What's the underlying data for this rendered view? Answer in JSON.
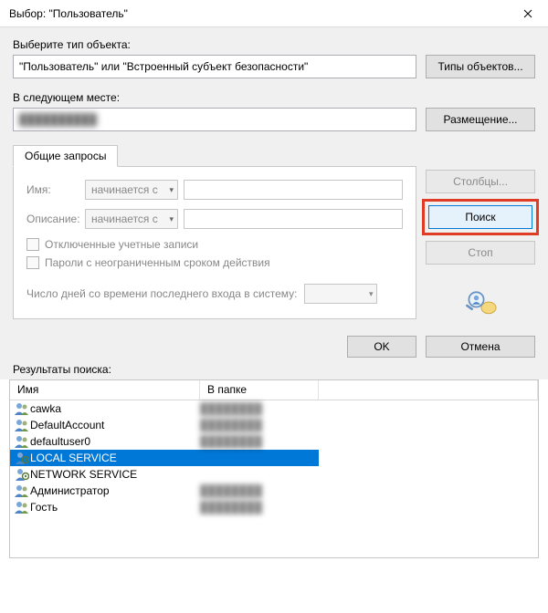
{
  "titlebar": {
    "title": "Выбор: \"Пользователь\""
  },
  "section": {
    "object_type_label": "Выберите тип объекта:",
    "object_type_value": "\"Пользователь\" или \"Встроенный субъект безопасности\"",
    "object_types_button": "Типы объектов...",
    "location_label": "В следующем месте:",
    "location_value": "██████████",
    "locations_button": "Размещение..."
  },
  "tabs": {
    "common_queries": "Общие запросы"
  },
  "query": {
    "name_label": "Имя:",
    "name_filter_mode": "начинается с",
    "desc_label": "Описание:",
    "desc_filter_mode": "начинается с",
    "disabled_accounts": "Отключенные учетные записи",
    "no_expire_passwords": "Пароли с неограниченным сроком действия",
    "last_login_label": "Число дней со времени последнего входа в систему:"
  },
  "side_buttons": {
    "columns": "Столбцы...",
    "search": "Поиск",
    "stop": "Стоп"
  },
  "okcancel": {
    "ok": "OK",
    "cancel": "Отмена"
  },
  "results": {
    "label": "Результаты поиска:",
    "columns": {
      "name": "Имя",
      "folder": "В папке"
    },
    "rows": [
      {
        "icon": "user",
        "name": "cawka",
        "folder": "████████",
        "selected": false
      },
      {
        "icon": "user",
        "name": "DefaultAccount",
        "folder": "████████",
        "selected": false
      },
      {
        "icon": "user",
        "name": "defaultuser0",
        "folder": "████████",
        "selected": false
      },
      {
        "icon": "serviceuser",
        "name": "LOCAL SERVICE",
        "folder": "",
        "selected": true
      },
      {
        "icon": "serviceuser",
        "name": "NETWORK SERVICE",
        "folder": "",
        "selected": false
      },
      {
        "icon": "user",
        "name": "Администратор",
        "folder": "████████",
        "selected": false
      },
      {
        "icon": "user",
        "name": "Гость",
        "folder": "████████",
        "selected": false
      }
    ]
  }
}
